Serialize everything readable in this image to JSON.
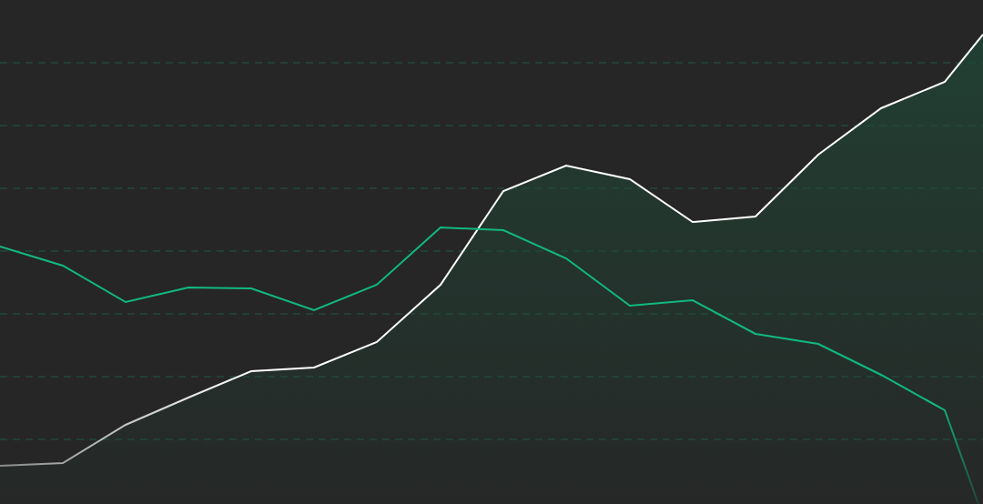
{
  "chart": {
    "series": [
      {
        "color": "#ffffff"
      },
      {
        "color": "#10b981"
      }
    ]
  }
}
